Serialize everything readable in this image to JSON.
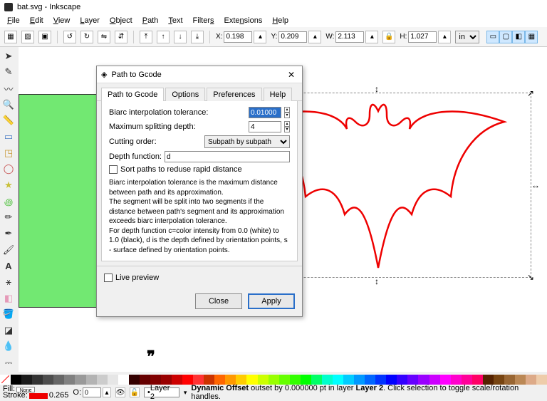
{
  "title": "bat.svg - Inkscape",
  "menu": {
    "file": "File",
    "edit": "Edit",
    "view": "View",
    "layer": "Layer",
    "object": "Object",
    "path": "Path",
    "text": "Text",
    "filters": "Filters",
    "extensions": "Extensions",
    "help": "Help"
  },
  "coords": {
    "xlabel": "X:",
    "x": "0.198",
    "ylabel": "Y:",
    "y": "0.209",
    "wlabel": "W:",
    "w": "2.113",
    "hlabel": "H:",
    "h": "1.027",
    "unit": "in"
  },
  "dialog": {
    "title": "Path to Gcode",
    "tabs": {
      "t1": "Path to Gcode",
      "t2": "Options",
      "t3": "Preferences",
      "t4": "Help"
    },
    "biarc_label": "Biarc interpolation tolerance:",
    "biarc_val": "0.01000",
    "depth_label": "Maximum splitting depth:",
    "depth_val": "4",
    "cut_label": "Cutting order:",
    "cut_val": "Subpath by subpath",
    "dfn_label": "Depth function:",
    "dfn_val": "d",
    "sort_label": "Sort paths to reduse rapid distance",
    "desc": "Biarc interpolation tolerance is the maximum distance between path and its approximation.\nThe segment will be split into two segments if the distance between path's segment and its approximation exceeds biarc interpolation tolerance.\nFor depth function c=color intensity from 0.0 (white) to 1.0 (black), d is the depth defined by orientation points, s - surface defined by orientation points.",
    "live": "Live preview",
    "close": "Close",
    "apply": "Apply"
  },
  "status": {
    "fill_label": "Fill:",
    "fill_val": "None",
    "stroke_label": "Stroke:",
    "stroke_val": "0.265",
    "o_label": "O:",
    "o_val": "0",
    "layer_label": "Layer 2",
    "msg": "Dynamic Offset outset by 0.000000 pt in layer Layer 2. Click selection to toggle scale/rotation handles."
  },
  "palette": [
    "#000000",
    "#1a1a1a",
    "#333333",
    "#4d4d4d",
    "#666666",
    "#808080",
    "#999999",
    "#b3b3b3",
    "#cccccc",
    "#e6e6e6",
    "#ffffff",
    "#330000",
    "#660000",
    "#800000",
    "#990000",
    "#cc0000",
    "#ff0000",
    "#ff3333",
    "#cc3300",
    "#ff6600",
    "#ff9900",
    "#ffcc00",
    "#ffff00",
    "#ccff00",
    "#99ff00",
    "#66ff00",
    "#33ff00",
    "#00ff00",
    "#00ff66",
    "#00ffcc",
    "#00ffff",
    "#00ccff",
    "#0099ff",
    "#0066ff",
    "#0033ff",
    "#0000ff",
    "#3300ff",
    "#6600ff",
    "#9900ff",
    "#cc00ff",
    "#ff00ff",
    "#ff00cc",
    "#ff0099",
    "#ff0066",
    "#552200",
    "#774411",
    "#996633",
    "#bb8855",
    "#ddaa88",
    "#eeccaa"
  ]
}
